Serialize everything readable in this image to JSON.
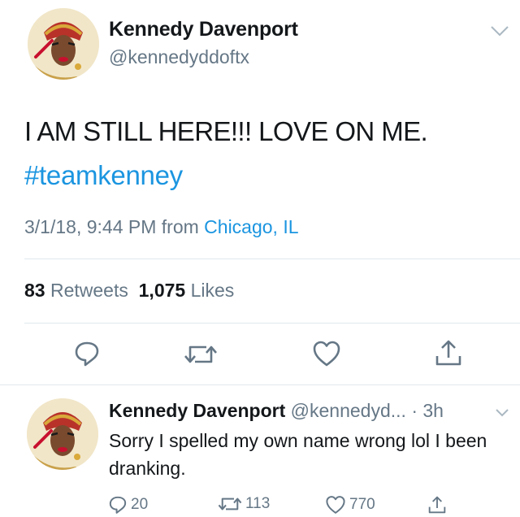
{
  "tweet": {
    "display_name": "Kennedy Davenport",
    "handle": "@kennedyddoftx",
    "text": "I AM STILL HERE!!! LOVE ON ME.",
    "hashtag": "#teamkenney",
    "timestamp": "3/1/18, 9:44 PM from ",
    "location": "Chicago, IL",
    "retweets_count": "83",
    "retweets_label": "Retweets",
    "likes_count": "1,075",
    "likes_label": "Likes"
  },
  "reply": {
    "display_name": "Kennedy Davenport",
    "meta": " @kennedyd... · 3h",
    "text": "Sorry I spelled my own name wrong lol I been dranking.",
    "reply_count": "20",
    "retweet_count": "113",
    "like_count": "770"
  },
  "icons": {
    "reply": "reply-icon",
    "retweet": "retweet-icon",
    "like": "heart-icon",
    "share": "share-icon",
    "menu": "chevron-down-icon"
  },
  "colors": {
    "link": "#1b95e0",
    "secondary": "#657786",
    "primary": "#14171a",
    "divider": "#e1e8ed"
  }
}
